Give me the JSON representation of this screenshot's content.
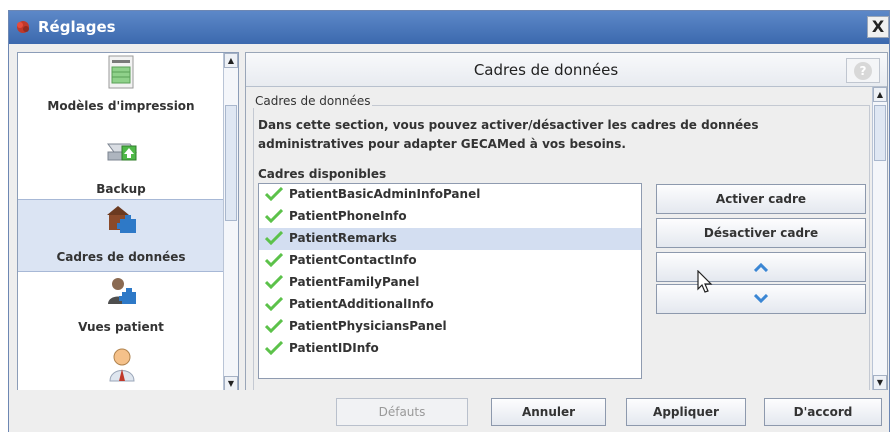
{
  "window": {
    "title": "Réglages",
    "close_label": "X"
  },
  "sidebar": {
    "items": [
      {
        "label": "Modèles d'impression",
        "icon": "print-template-icon"
      },
      {
        "label": "Backup",
        "icon": "backup-drive-icon"
      },
      {
        "label": "Cadres de données",
        "icon": "data-frames-icon",
        "selected": true
      },
      {
        "label": "Vues patient",
        "icon": "patient-views-icon"
      },
      {
        "label": "",
        "icon": "user-icon"
      }
    ]
  },
  "main": {
    "header_title": "Cadres de données",
    "help_label": "?",
    "group_title": "Cadres de données",
    "description": "Dans cette section, vous pouvez activer/désactiver les cadres de données administratives pour adapter GECAMed à vos besoins.",
    "available_label": "Cadres disponibles",
    "frames": [
      "PatientBasicAdminInfoPanel",
      "PatientPhoneInfo",
      "PatientRemarks",
      "PatientContactInfo",
      "PatientFamilyPanel",
      "PatientAdditionalInfo",
      "PatientPhysiciansPanel",
      "PatientIDInfo"
    ],
    "selected_index": 2,
    "buttons": {
      "activate": "Activer cadre",
      "deactivate": "Désactiver cadre",
      "up_icon": "chevron-up-icon",
      "down_icon": "chevron-down-icon"
    }
  },
  "footer": {
    "defaults": "Défauts",
    "cancel": "Annuler",
    "apply": "Appliquer",
    "ok": "D'accord"
  },
  "colors": {
    "titlebar": "#4a76ba",
    "selection": "#d3def1",
    "check": "#5cc24a",
    "arrow": "#3a86d4"
  }
}
